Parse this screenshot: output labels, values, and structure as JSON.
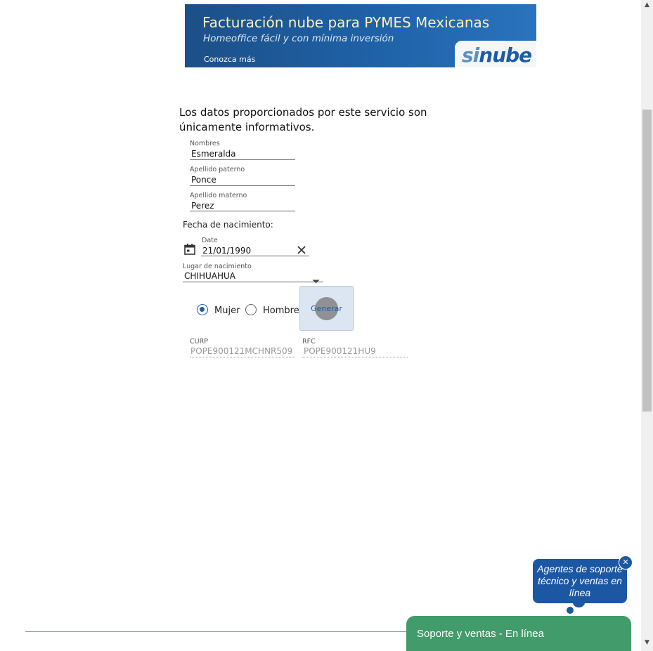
{
  "banner": {
    "title": "Facturación nube para PYMES Mexicanas",
    "subtitle": "Homeoffice fácil y con mínima inversión",
    "cta": "Conozca más",
    "logo_prefix": "si",
    "logo_text": "nube"
  },
  "disclaimer": "Los datos proporcionados por este servicio son únicamente informativos.",
  "form": {
    "nombres": {
      "label": "Nombres",
      "value": "Esmeralda"
    },
    "apellido_paterno": {
      "label": "Apellido paterno",
      "value": "Ponce"
    },
    "apellido_materno": {
      "label": "Apellido materno",
      "value": "Perez"
    },
    "fecha_section_label": "Fecha de nacimiento:",
    "date": {
      "label": "Date",
      "value": "21/01/1990"
    },
    "lugar": {
      "label": "Lugar de nacimiento",
      "value": "CHIHUAHUA"
    },
    "sexo": {
      "options": [
        "Mujer",
        "Hombre"
      ],
      "selected": "Mujer"
    },
    "generar_label": "Generar",
    "curp": {
      "label": "CURP",
      "value": "POPE900121MCHNR509"
    },
    "rfc": {
      "label": "RFC",
      "value": "POPE900121HU9"
    }
  },
  "chat": {
    "bubble_text": "Agentes de soporte técnico y ventas en línea",
    "close_glyph": "✕",
    "bar_label": "Soporte y ventas - En línea"
  },
  "colors": {
    "primary_blue": "#1f5fa6",
    "chat_green": "#429b6a",
    "banner_title": "#fff1b8"
  }
}
